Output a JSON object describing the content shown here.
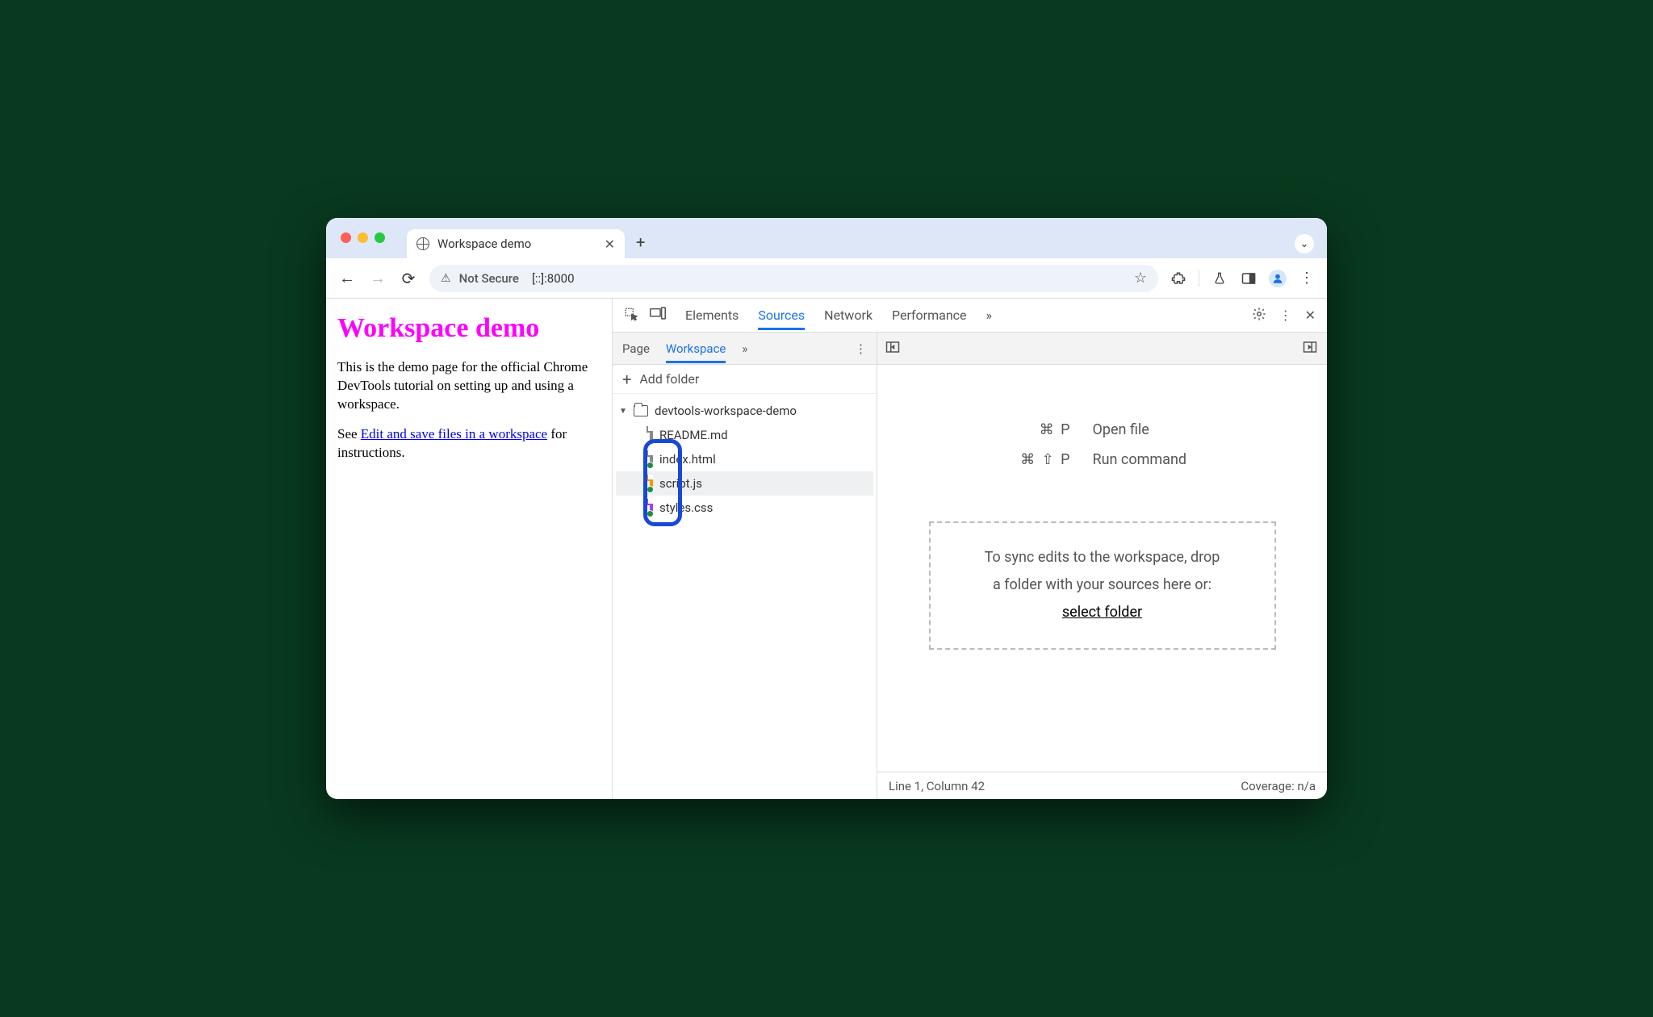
{
  "browser": {
    "tab_title": "Workspace demo",
    "not_secure": "Not Secure",
    "url": "[::]:8000"
  },
  "page": {
    "heading": "Workspace demo",
    "para1": "This is the demo page for the official Chrome DevTools tutorial on setting up and using a workspace.",
    "para2_prefix": "See ",
    "para2_link": "Edit and save files in a workspace",
    "para2_suffix": " for instructions."
  },
  "devtools": {
    "tabs": {
      "elements": "Elements",
      "sources": "Sources",
      "network": "Network",
      "performance": "Performance"
    },
    "sources": {
      "tabs": {
        "page": "Page",
        "workspace": "Workspace"
      },
      "add_folder": "Add folder",
      "folder": "devtools-workspace-demo",
      "files": {
        "readme": "README.md",
        "index": "index.html",
        "script": "script.js",
        "styles": "styles.css"
      }
    },
    "shortcuts": {
      "open_keys": "⌘ P",
      "open_label": "Open file",
      "run_keys": "⌘ ⇧ P",
      "run_label": "Run command"
    },
    "dropzone": {
      "line1": "To sync edits to the workspace, drop",
      "line2": "a folder with your sources here or:",
      "link": "select folder"
    },
    "status": {
      "position": "Line 1, Column 42",
      "coverage": "Coverage: n/a"
    }
  }
}
